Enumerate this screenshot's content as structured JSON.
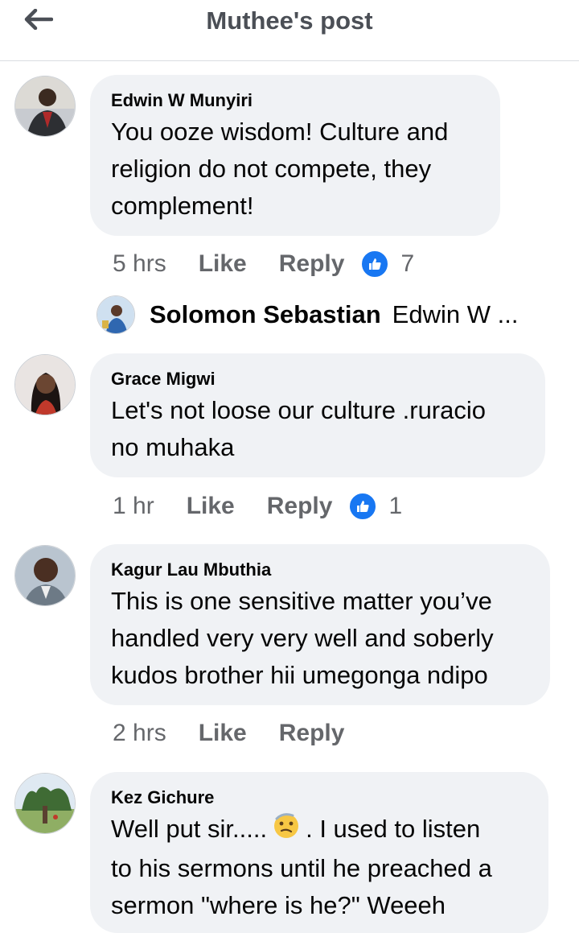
{
  "header": {
    "title": "Muthee's post",
    "back_icon": "arrow-left-icon"
  },
  "colors": {
    "bubble": "#f0f2f5",
    "secondary_text": "#65676b",
    "like_blue": "#1877f2"
  },
  "comments": [
    {
      "author": "Edwin W Munyiri",
      "lines": [
        "You ooze wisdom! Culture and",
        "religion do not compete, they",
        "complement!"
      ],
      "time": "5 hrs",
      "like": "Like",
      "reply": "Reply",
      "reaction_icon": "like-reaction-icon",
      "reaction_count": "7"
    },
    {
      "author": "Grace Migwi",
      "lines": [
        "Let's not loose our culture .ruracio",
        "no muhaka"
      ],
      "time": "1 hr",
      "like": "Like",
      "reply": "Reply",
      "reaction_icon": "like-reaction-icon",
      "reaction_count": "1"
    },
    {
      "author": "Kagur Lau Mbuthia",
      "lines": [
        "This is one sensitive matter you’ve",
        "handled very very well and soberly",
        "kudos brother hii umegonga ndipo"
      ],
      "time": "2 hrs",
      "like": "Like",
      "reply": "Reply"
    },
    {
      "author": "Kez Gichure",
      "line1_before": "Well put sir.....",
      "line1_after": ". I used to listen",
      "emoji_icon": "thinking-face-emoji",
      "lines_rest": [
        "to his sermons until he preached a",
        "sermon \"where is he?\" Weeeh"
      ]
    }
  ],
  "reply_preview": {
    "author": "Solomon Sebastian",
    "snippet": "Edwin W ..."
  }
}
